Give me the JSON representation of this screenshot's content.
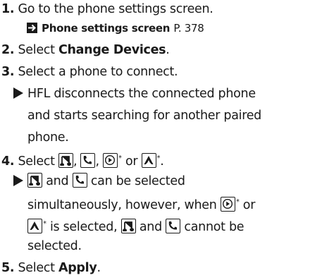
{
  "steps": {
    "s1": {
      "num": "1.",
      "text": "Go to the phone settings screen."
    },
    "ref": {
      "label": "Phone settings screen",
      "page": "P. 378"
    },
    "s2": {
      "num": "2.",
      "pre": "Select ",
      "bold": "Change Devices",
      "post": "."
    },
    "s3": {
      "num": "3.",
      "text": "Select a phone to connect."
    },
    "s3note": {
      "l1": "HFL disconnects the connected phone",
      "l2": "and starts searching for another paired",
      "l3": "phone."
    },
    "s4": {
      "num": "4.",
      "pre": "Select ",
      "or": " or ",
      "post": "."
    },
    "s4note": {
      "l1a": " and ",
      "l1b": " can be selected",
      "l2": "simultaneously, however, when ",
      "l2b": " or",
      "l3b": " is selected, ",
      "l3c": " and ",
      "l3d": " cannot be",
      "l4": "selected."
    },
    "s5": {
      "num": "5.",
      "pre": "Select ",
      "bold": "Apply",
      "post": "."
    }
  },
  "icons": [
    "music-icon",
    "phone-icon",
    "apple-carplay-icon",
    "android-auto-icon"
  ],
  "footnote_mark": "*"
}
